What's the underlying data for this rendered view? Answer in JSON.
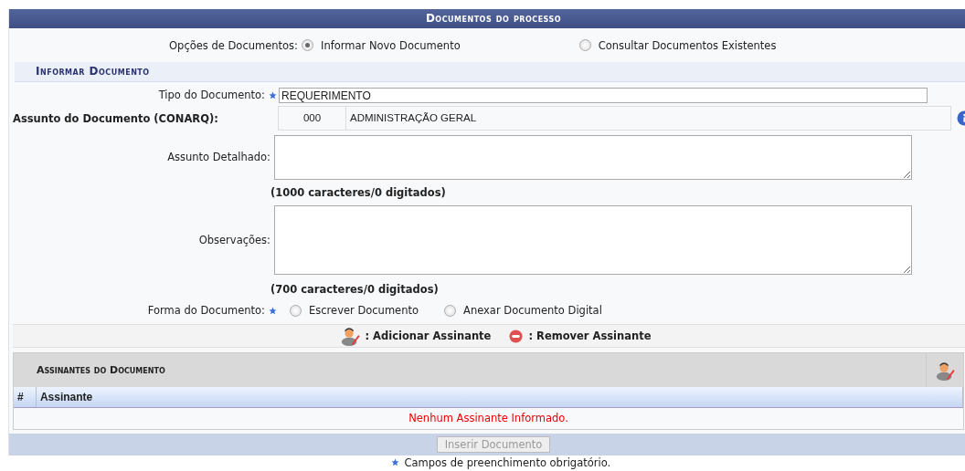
{
  "panel": {
    "title": "Documentos do processo"
  },
  "options": {
    "label": "Opções de Documentos:",
    "choices": [
      {
        "label": "Informar Novo Documento",
        "selected": true
      },
      {
        "label": "Consultar Documentos Existentes",
        "selected": false
      }
    ]
  },
  "section": {
    "title": "Informar Documento"
  },
  "tipo": {
    "label": "Tipo do Documento:",
    "required": true,
    "value": "REQUERIMENTO"
  },
  "assunto": {
    "label": "Assunto do Documento (CONARQ):",
    "code": "000",
    "name": "ADMINISTRAÇÃO GERAL"
  },
  "detalhado": {
    "label": "Assunto Detalhado:",
    "counter": "(1000 caracteres/0 digitados)"
  },
  "observacoes": {
    "label": "Observações:",
    "counter": "(700 caracteres/0 digitados)"
  },
  "forma": {
    "label": "Forma do Documento:",
    "required": true,
    "choices": [
      {
        "label": "Escrever Documento",
        "selected": false
      },
      {
        "label": "Anexar Documento Digital",
        "selected": false
      }
    ]
  },
  "legend": {
    "add": ": Adicionar Assinante",
    "remove": ": Remover Assinante"
  },
  "signers": {
    "title": "Assinantes do Documento",
    "columns": [
      "#",
      "Assinante"
    ],
    "empty": "Nenhum Assinante Informado."
  },
  "submit": {
    "label": "Inserir Documento",
    "disabled": true
  },
  "note": "Campos de preenchimento obrigatório."
}
